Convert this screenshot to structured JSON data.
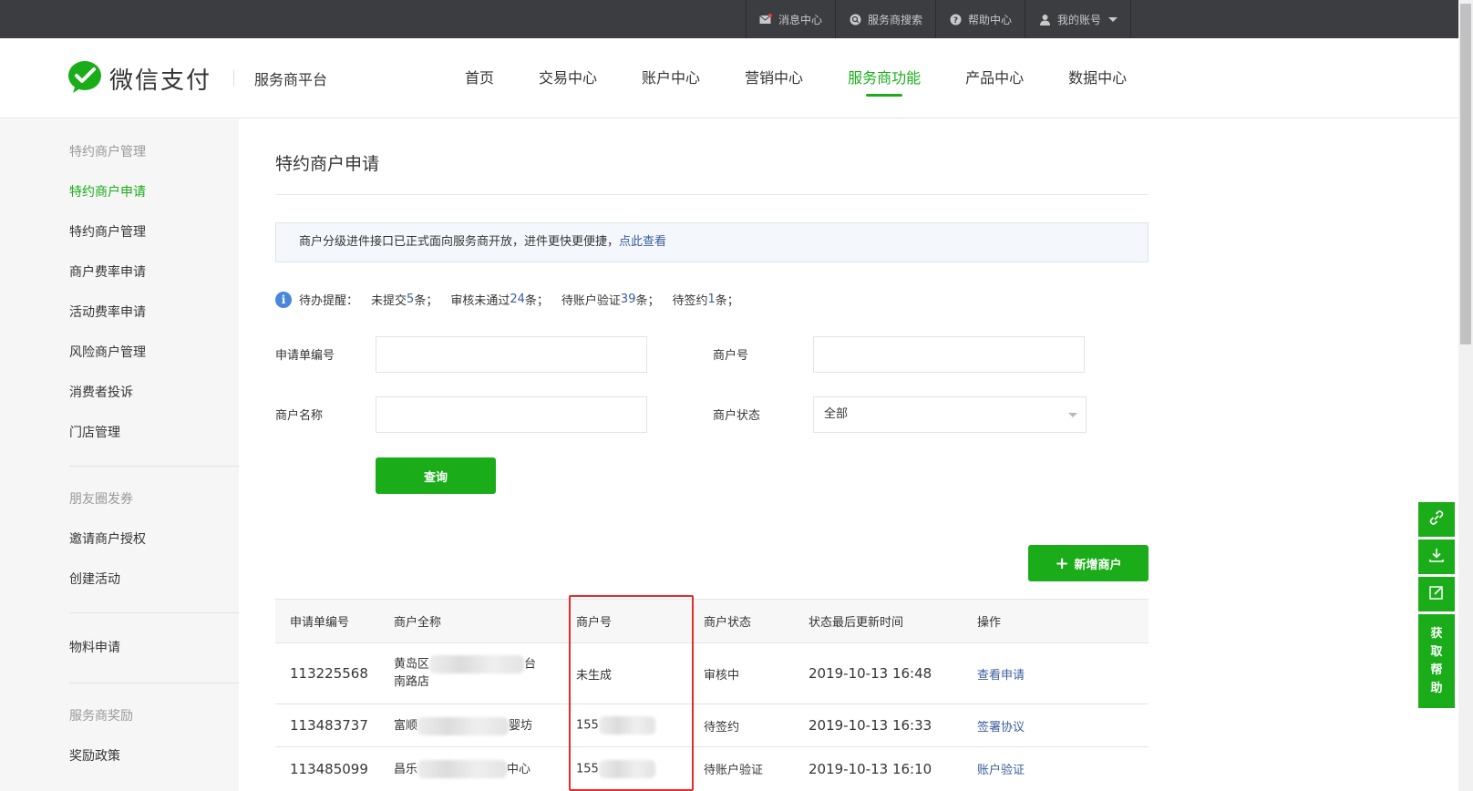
{
  "topbar": {
    "links": [
      {
        "label": "消息中心",
        "icon": "mail-icon"
      },
      {
        "label": "服务商搜索",
        "icon": "search-icon"
      },
      {
        "label": "帮助中心",
        "icon": "help-icon"
      },
      {
        "label": "我的账号",
        "icon": "user-icon"
      }
    ]
  },
  "header": {
    "brand": "微信支付",
    "subtitle": "服务商平台",
    "nav": [
      "首页",
      "交易中心",
      "账户中心",
      "营销中心",
      "服务商功能",
      "产品中心",
      "数据中心"
    ],
    "active_nav": "服务商功能"
  },
  "sidebar": {
    "groups": [
      {
        "title": "特约商户管理",
        "items": [
          "特约商户申请",
          "特约商户管理",
          "商户费率申请",
          "活动费率申请",
          "风险商户管理",
          "消费者投诉",
          "门店管理"
        ]
      },
      {
        "title": "朋友圈发券",
        "items": [
          "邀请商户授权",
          "创建活动"
        ]
      },
      {
        "title": "",
        "items": [
          "物料申请"
        ]
      },
      {
        "title": "服务商奖励",
        "items": [
          "奖励政策"
        ]
      }
    ],
    "active_item": "特约商户申请"
  },
  "page": {
    "title": "特约商户申请",
    "notice_text": "商户分级进件接口已正式面向服务商开放，进件更快更便捷，",
    "notice_link": "点此查看",
    "todo": {
      "label": "待办提醒：",
      "a_pre": "未提交",
      "a_num": "5",
      "a_suf": "条；",
      "b_pre": "审核未通过",
      "b_num": "24",
      "b_suf": "条；",
      "c_pre": "待账户验证",
      "c_num": "39",
      "c_suf": "条；",
      "d_pre": "待签约",
      "d_num": "1",
      "d_suf": "条；"
    }
  },
  "form": {
    "app_no_label": "申请单编号",
    "app_no_value": "",
    "merchant_no_label": "商户号",
    "merchant_no_value": "",
    "merchant_name_label": "商户名称",
    "merchant_name_value": "",
    "status_label": "商户状态",
    "status_value": "全部",
    "query_button": "查询",
    "add_button": "新增商户"
  },
  "table": {
    "headers": [
      "申请单编号",
      "商户全称",
      "商户号",
      "商户状态",
      "状态最后更新时间",
      "操作"
    ],
    "rows": [
      {
        "id": "113225568",
        "name_start": "黄岛区",
        "name_end": "台",
        "name_line2": "南路店",
        "merchant_no": "未生成",
        "status": "审核中",
        "time": "2019-10-13 16:48",
        "action": "查看申请"
      },
      {
        "id": "113483737",
        "name_start": "富顺",
        "name_end": "婴坊",
        "name_line2": "",
        "merchant_no": "155",
        "status": "待签约",
        "time": "2019-10-13 16:33",
        "action": "签署协议"
      },
      {
        "id": "113485099",
        "name_start": "昌乐",
        "name_end": "中心",
        "name_line2": "",
        "merchant_no": "155",
        "status": "待账户验证",
        "time": "2019-10-13 16:10",
        "action": "账户验证"
      }
    ]
  },
  "float": {
    "help_chars": [
      "获",
      "取",
      "帮",
      "助"
    ]
  },
  "colors": {
    "brand_green": "#1aad19",
    "link_blue": "#3b5d9c",
    "highlight_red": "#e62b2b"
  }
}
